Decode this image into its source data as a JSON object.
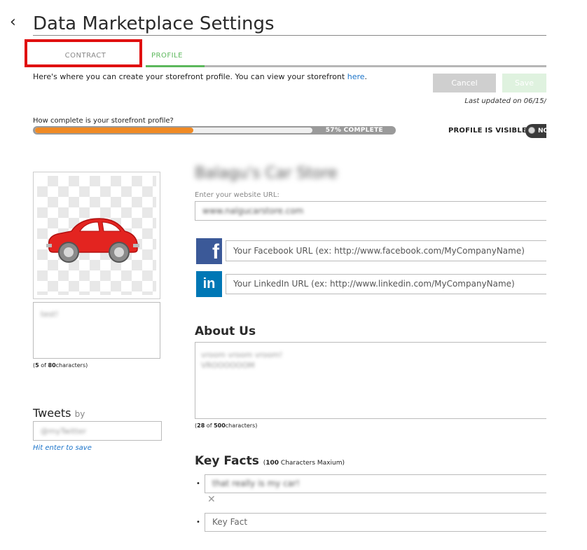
{
  "header": {
    "back_icon": "‹",
    "title": "Data Marketplace Settings"
  },
  "tabs": [
    {
      "label": "CONTRACT"
    },
    {
      "label": "PROFILE"
    }
  ],
  "intro": {
    "text": "Here's where you can create your storefront profile. You can view your storefront ",
    "link": "here",
    "suffix": "."
  },
  "actions": {
    "cancel": "Cancel",
    "save": "Save",
    "last_updated": "Last updated on 06/15/"
  },
  "progress": {
    "question": "How complete is your storefront profile?",
    "percent": 57,
    "text": "57% COMPLETE"
  },
  "visibility": {
    "label": "PROFILE IS VISIBLE",
    "toggle_text": "NO"
  },
  "profile_image": {
    "alt": "red car"
  },
  "tagline": {
    "value": "test!",
    "count_current": "5",
    "count_of": " of ",
    "count_max": "80",
    "count_suffix": "characters)",
    "count_open": "("
  },
  "tweets": {
    "title": "Tweets",
    "by": "by",
    "value": "@myTwitter",
    "hint": "Hit enter to save"
  },
  "store": {
    "name": "Balagu's Car Store",
    "url_label": "Enter your website URL:",
    "url_value": "www.nalgucarstore.com"
  },
  "social": {
    "facebook_placeholder": "Your Facebook URL (ex: http://www.facebook.com/MyCompanyName)",
    "linkedin_placeholder": "Your LinkedIn URL (ex: http://www.linkedin.com/MyCompanyName)",
    "facebook_icon": "f",
    "linkedin_icon": "in"
  },
  "about": {
    "title": "About Us",
    "line1": "vroom vroom vroom!",
    "line2": "VROOOOOOM",
    "count_open": "(",
    "count_current": "28",
    "count_of": " of ",
    "count_max": "500",
    "count_suffix": "characters)"
  },
  "key_facts": {
    "title": "Key Facts",
    "note_max": "100",
    "note_text": " Characters Maxium)",
    "note_open": "(",
    "bullet": "•",
    "fact1": "that really is my car!",
    "remove_icon": "✕",
    "placeholder": "Key Fact"
  },
  "colors": {
    "accent_green": "#5cb85c",
    "progress_orange": "#f08a24",
    "link_blue": "#1a73c9",
    "highlight_red": "#e01010"
  }
}
